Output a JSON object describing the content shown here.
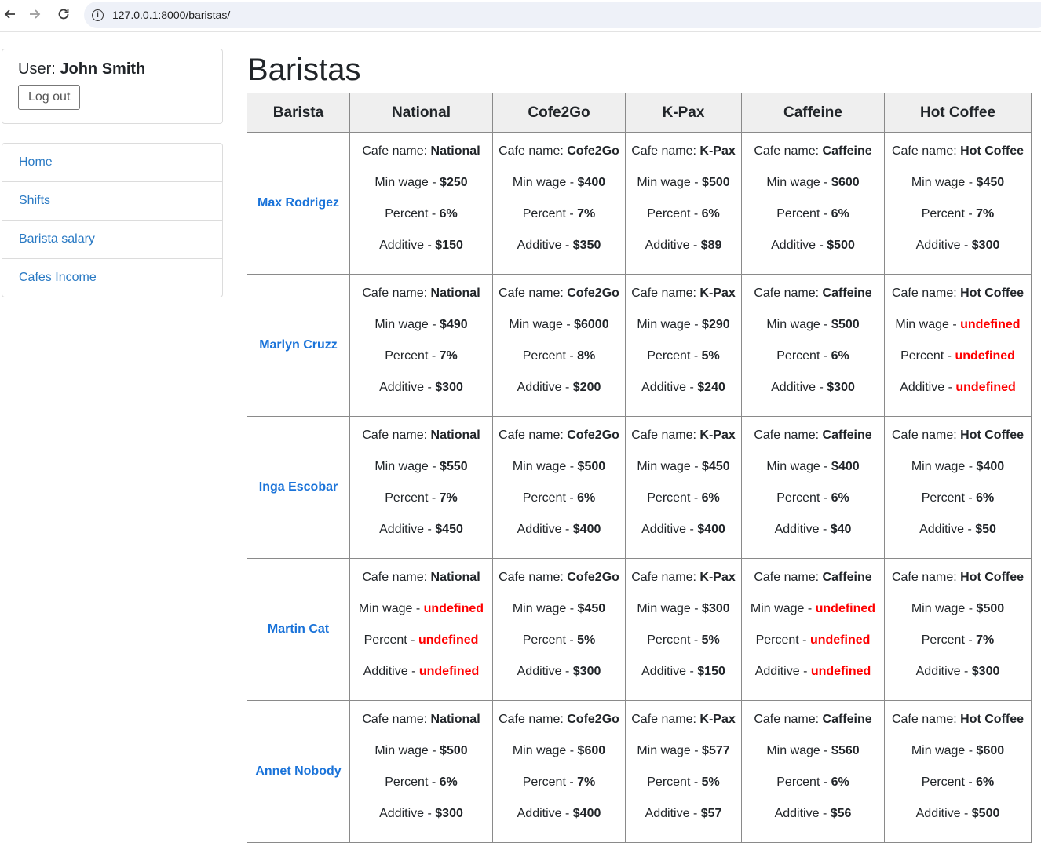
{
  "browser": {
    "url": "127.0.0.1:8000/baristas/"
  },
  "user": {
    "prefix": "User:",
    "name": "John Smith",
    "logout_label": "Log out"
  },
  "menu": [
    {
      "label": "Home"
    },
    {
      "label": "Shifts"
    },
    {
      "label": "Barista salary"
    },
    {
      "label": "Cafes Income"
    }
  ],
  "page_title": "Baristas",
  "labels": {
    "cafe_name": "Cafe name:",
    "min_wage": "Min wage - ",
    "percent": "Percent - ",
    "additive": "Additive - "
  },
  "columns": [
    "Barista",
    "National",
    "Cofe2Go",
    "K-Pax",
    "Caffeine",
    "Hot Coffee"
  ],
  "rows": [
    {
      "barista": "Max Rodrigez",
      "cafes": [
        {
          "name": "National",
          "min_wage": "$250",
          "percent": "6%",
          "additive": "$150"
        },
        {
          "name": "Cofe2Go",
          "min_wage": "$400",
          "percent": "7%",
          "additive": "$350"
        },
        {
          "name": "K-Pax",
          "min_wage": "$500",
          "percent": "6%",
          "additive": "$89"
        },
        {
          "name": "Caffeine",
          "min_wage": "$600",
          "percent": "6%",
          "additive": "$500"
        },
        {
          "name": "Hot Coffee",
          "min_wage": "$450",
          "percent": "7%",
          "additive": "$300"
        }
      ]
    },
    {
      "barista": "Marlyn Cruzz",
      "cafes": [
        {
          "name": "National",
          "min_wage": "$490",
          "percent": "7%",
          "additive": "$300"
        },
        {
          "name": "Cofe2Go",
          "min_wage": "$6000",
          "percent": "8%",
          "additive": "$200"
        },
        {
          "name": "K-Pax",
          "min_wage": "$290",
          "percent": "5%",
          "additive": "$240"
        },
        {
          "name": "Caffeine",
          "min_wage": "$500",
          "percent": "6%",
          "additive": "$300"
        },
        {
          "name": "Hot Coffee",
          "min_wage": "undefined",
          "percent": "undefined",
          "additive": "undefined"
        }
      ]
    },
    {
      "barista": "Inga Escobar",
      "cafes": [
        {
          "name": "National",
          "min_wage": "$550",
          "percent": "7%",
          "additive": "$450"
        },
        {
          "name": "Cofe2Go",
          "min_wage": "$500",
          "percent": "6%",
          "additive": "$400"
        },
        {
          "name": "K-Pax",
          "min_wage": "$450",
          "percent": "6%",
          "additive": "$400"
        },
        {
          "name": "Caffeine",
          "min_wage": "$400",
          "percent": "6%",
          "additive": "$40"
        },
        {
          "name": "Hot Coffee",
          "min_wage": "$400",
          "percent": "6%",
          "additive": "$50"
        }
      ]
    },
    {
      "barista": "Martin Cat",
      "cafes": [
        {
          "name": "National",
          "min_wage": "undefined",
          "percent": "undefined",
          "additive": "undefined"
        },
        {
          "name": "Cofe2Go",
          "min_wage": "$450",
          "percent": "5%",
          "additive": "$300"
        },
        {
          "name": "K-Pax",
          "min_wage": "$300",
          "percent": "5%",
          "additive": "$150"
        },
        {
          "name": "Caffeine",
          "min_wage": "undefined",
          "percent": "undefined",
          "additive": "undefined"
        },
        {
          "name": "Hot Coffee",
          "min_wage": "$500",
          "percent": "7%",
          "additive": "$300"
        }
      ]
    },
    {
      "barista": "Annet Nobody",
      "cafes": [
        {
          "name": "National",
          "min_wage": "$500",
          "percent": "6%",
          "additive": "$300"
        },
        {
          "name": "Cofe2Go",
          "min_wage": "$600",
          "percent": "7%",
          "additive": "$400"
        },
        {
          "name": "K-Pax",
          "min_wage": "$577",
          "percent": "5%",
          "additive": "$57"
        },
        {
          "name": "Caffeine",
          "min_wage": "$560",
          "percent": "6%",
          "additive": "$56"
        },
        {
          "name": "Hot Coffee",
          "min_wage": "$600",
          "percent": "6%",
          "additive": "$500"
        }
      ]
    }
  ],
  "colors": {
    "link": "#1a73d9",
    "undefined_value": "#ff0000",
    "header_bg": "#efefef"
  }
}
